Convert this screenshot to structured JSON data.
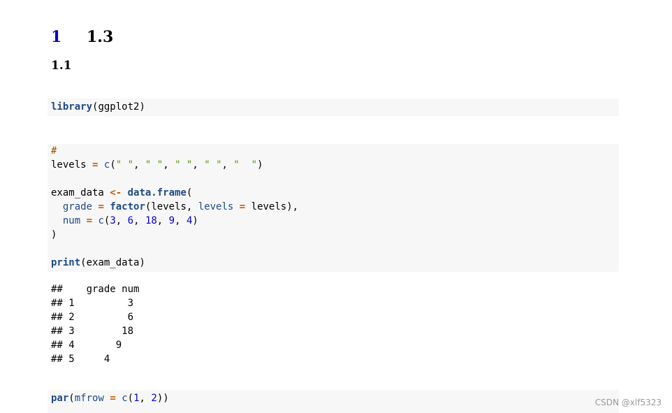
{
  "section": {
    "number": "1",
    "title": "1.3"
  },
  "subsection": {
    "title": "1.1"
  },
  "code1": {
    "fn": "library",
    "rest": "(ggplot2)"
  },
  "code2": {
    "comment": "#",
    "levels_var": "levels ",
    "eq1": "=",
    "c_fn": "c",
    "open1": "(",
    "s1": "\" \"",
    "s2": "\" \"",
    "s3": "\" \"",
    "s4": "\" \"",
    "s5": "\"  \"",
    "comma": ", ",
    "close1": ")",
    "exam_var": "exam_data ",
    "assign": "<-",
    "df_fn": "data.frame",
    "df_open": "(",
    "grade_arg": "grade",
    "eq2": "=",
    "factor_fn": "factor",
    "factor_args_a": "(levels, ",
    "levels_arg": "levels",
    "eq3": "=",
    "factor_args_b": " levels),",
    "num_arg": "num",
    "eq4": "=",
    "c_fn2": "c",
    "n1": "3",
    "n2": "6",
    "n3": "18",
    "n4": "9",
    "n5": "4",
    "close_paren": ")",
    "print_fn": "print",
    "print_args": "(exam_data)"
  },
  "output": {
    "lines": [
      "##    grade num",
      "## 1         3",
      "## 2         6",
      "## 3        18",
      "## 4       9",
      "## 5     4"
    ]
  },
  "code3": {
    "fn": "par",
    "open": "(",
    "arg": "mfrow",
    "eq": "=",
    "c_fn": "c",
    "n1": "1",
    "n2": "2",
    "close": "))"
  },
  "watermark": "CSDN @xlf5323"
}
